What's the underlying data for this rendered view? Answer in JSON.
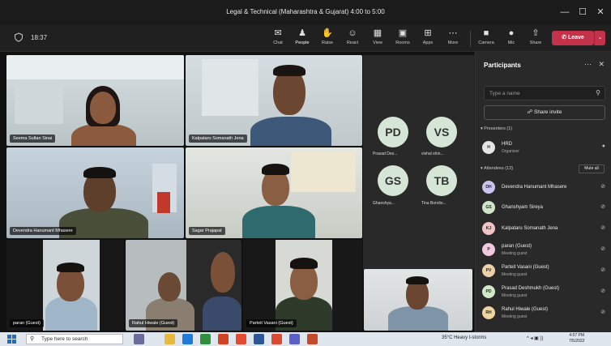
{
  "window": {
    "title": "Legal & Technical (Maharashtra & Gujarat) 4:00 to 5:00",
    "minimize": "—",
    "maximize": "☐",
    "close": "✕"
  },
  "toolbar": {
    "timer": "18:37",
    "buttons": [
      {
        "label": "Chat",
        "icon": "chat-icon"
      },
      {
        "label": "People",
        "icon": "people-icon"
      },
      {
        "label": "Raise",
        "icon": "raise-hand-icon"
      },
      {
        "label": "React",
        "icon": "react-icon"
      },
      {
        "label": "View",
        "icon": "view-icon"
      },
      {
        "label": "Rooms",
        "icon": "rooms-icon"
      },
      {
        "label": "Apps",
        "icon": "apps-icon"
      },
      {
        "label": "More",
        "icon": "more-icon"
      },
      {
        "label": "Camera",
        "icon": "camera-icon"
      },
      {
        "label": "Mic",
        "icon": "mic-icon"
      },
      {
        "label": "Share",
        "icon": "share-icon"
      }
    ],
    "leave_label": "Leave"
  },
  "video_tiles": [
    {
      "name": "Seema Sultan Sinai"
    },
    {
      "name": "Kalpataru Somanath Jena"
    },
    {
      "name": "Devendra Hanumant Mhasere"
    },
    {
      "name": "Sagar Prajapat"
    },
    {
      "name": "paran (Guest)"
    },
    {
      "name": "Rahul Hiwale (Guest)"
    },
    {
      "name": "Parteit Vasani (Guest)"
    }
  ],
  "avatar_tiles": [
    {
      "initials": "PD",
      "name": "Prasad Des..."
    },
    {
      "initials": "VS",
      "name": "vishal shin..."
    },
    {
      "initials": "GS",
      "name": "Ghanshya..."
    },
    {
      "initials": "TB",
      "name": "Tina Borolio..."
    }
  ],
  "participants": {
    "title": "Participants",
    "search_placeholder": "Type a name",
    "share_invite": "Share invite",
    "presenters_header": "Presenters (1)",
    "attendees_header": "Attendees (13)",
    "mute_all": "Mute all",
    "presenters": [
      {
        "initials": "H",
        "name": "HRD",
        "role": "Organizer",
        "color": "#e5e5e5"
      }
    ],
    "attendees": [
      {
        "initials": "DH",
        "name": "Devendra Hanumant Mhasere",
        "role": "",
        "color": "#c9c3f0"
      },
      {
        "initials": "GS",
        "name": "Ghanshyam Sireya",
        "role": "",
        "color": "#cfe5c8"
      },
      {
        "initials": "KJ",
        "name": "Kalpataru Somanath Jena",
        "role": "",
        "color": "#f0c4c4"
      },
      {
        "initials": "P",
        "name": "paran (Guest)",
        "role": "Meeting guest",
        "color": "#f0c8e0"
      },
      {
        "initials": "PV",
        "name": "Parteit Vasani (Guest)",
        "role": "Meeting guest",
        "color": "#ecd0a8"
      },
      {
        "initials": "PD",
        "name": "Prasad Deshmukh (Guest)",
        "role": "Meeting guest",
        "color": "#d0e8c8"
      },
      {
        "initials": "RH",
        "name": "Rahul Hiwale (Guest)",
        "role": "Meeting guest",
        "color": "#f0d4a0"
      }
    ]
  },
  "taskbar": {
    "search_placeholder": "Type here to search",
    "weather": "35°C  Heavy t-storms",
    "tray": "^ ◂ ▣ ))",
    "time": "4:07 PM",
    "date": "7/5/2022"
  }
}
